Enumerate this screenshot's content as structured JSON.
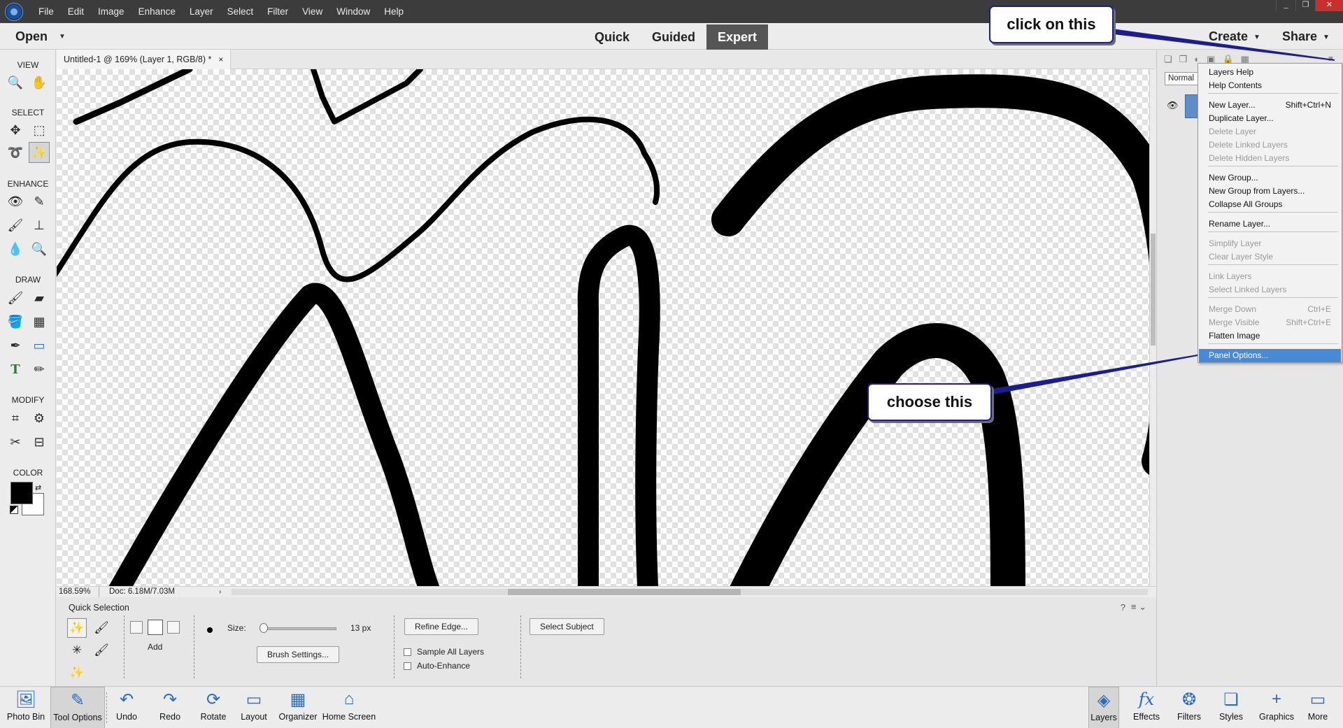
{
  "menubar": {
    "items": [
      "File",
      "Edit",
      "Image",
      "Enhance",
      "Layer",
      "Select",
      "Filter",
      "View",
      "Window",
      "Help"
    ],
    "window_controls": [
      "_",
      "❐",
      "✕"
    ]
  },
  "modebar": {
    "open_label": "Open",
    "modes": [
      "Quick",
      "Guided",
      "Expert"
    ],
    "active_mode": "Expert",
    "create_label": "Create",
    "share_label": "Share"
  },
  "toolbox": {
    "sections": [
      "VIEW",
      "SELECT",
      "ENHANCE",
      "DRAW",
      "MODIFY",
      "COLOR"
    ],
    "tools": [
      {
        "name": "zoom-tool-icon",
        "glyph": "🔍"
      },
      {
        "name": "hand-tool-icon",
        "glyph": "✋"
      },
      {
        "name": "move-tool-icon",
        "glyph": "✥"
      },
      {
        "name": "marquee-tool-icon",
        "glyph": "⬚"
      },
      {
        "name": "lasso-tool-icon",
        "glyph": "➰"
      },
      {
        "name": "quick-selection-tool-icon",
        "glyph": "✨"
      },
      {
        "name": "red-eye-tool-icon",
        "glyph": "👁"
      },
      {
        "name": "spot-healing-tool-icon",
        "glyph": "✎"
      },
      {
        "name": "smart-brush-tool-icon",
        "glyph": "🖌"
      },
      {
        "name": "clone-stamp-tool-icon",
        "glyph": "⊥"
      },
      {
        "name": "blur-tool-icon",
        "glyph": "💧"
      },
      {
        "name": "sponge-tool-icon",
        "glyph": "🔍"
      },
      {
        "name": "brush-tool-icon",
        "glyph": "🖌"
      },
      {
        "name": "eraser-tool-icon",
        "glyph": "▰"
      },
      {
        "name": "paint-bucket-tool-icon",
        "glyph": "🪣"
      },
      {
        "name": "gradient-tool-icon",
        "glyph": "▦"
      },
      {
        "name": "eyedropper-tool-icon",
        "glyph": "✒"
      },
      {
        "name": "shape-tool-icon",
        "glyph": "▭"
      },
      {
        "name": "type-tool-icon",
        "glyph": "T"
      },
      {
        "name": "pencil-tool-icon",
        "glyph": "✏"
      },
      {
        "name": "crop-tool-icon",
        "glyph": "⌗"
      },
      {
        "name": "recompose-tool-icon",
        "glyph": "⚙"
      },
      {
        "name": "content-aware-move-tool-icon",
        "glyph": "✂"
      },
      {
        "name": "straighten-tool-icon",
        "glyph": "⊟"
      }
    ]
  },
  "document": {
    "tab_title": "Untitled-1 @ 169% (Layer 1, RGB/8) *",
    "close_glyph": "×"
  },
  "status": {
    "zoom": "168.59%",
    "doc_size": "Doc: 6.18M/7.03M",
    "arrow": "›"
  },
  "tool_options": {
    "title": "Quick Selection",
    "mode_label": "Add",
    "size_label": "Size:",
    "size_value": "13 px",
    "size_fraction": 0.05,
    "brush_settings": "Brush Settings...",
    "refine_edge": "Refine Edge...",
    "sample_all_layers": "Sample All Layers",
    "auto_enhance": "Auto-Enhance",
    "select_subject": "Select Subject",
    "help_glyph": "?",
    "menu_glyph": "≡ ⌄"
  },
  "layers_panel": {
    "blend_mode": "Normal",
    "eye_glyph": "👁",
    "menu_glyph": "≡"
  },
  "context_menu": {
    "items": [
      {
        "label": "Layers Help",
        "shortcut": "",
        "disabled": false,
        "sep_before": false
      },
      {
        "label": "Help Contents",
        "shortcut": "",
        "disabled": false,
        "sep_before": false
      },
      {
        "label": "New Layer...",
        "shortcut": "Shift+Ctrl+N",
        "disabled": false,
        "sep_before": true
      },
      {
        "label": "Duplicate Layer...",
        "shortcut": "",
        "disabled": false,
        "sep_before": false
      },
      {
        "label": "Delete Layer",
        "shortcut": "",
        "disabled": true,
        "sep_before": false
      },
      {
        "label": "Delete Linked Layers",
        "shortcut": "",
        "disabled": true,
        "sep_before": false
      },
      {
        "label": "Delete Hidden Layers",
        "shortcut": "",
        "disabled": true,
        "sep_before": false
      },
      {
        "label": "New Group...",
        "shortcut": "",
        "disabled": false,
        "sep_before": true
      },
      {
        "label": "New Group from Layers...",
        "shortcut": "",
        "disabled": false,
        "sep_before": false
      },
      {
        "label": "Collapse All Groups",
        "shortcut": "",
        "disabled": false,
        "sep_before": false
      },
      {
        "label": "Rename Layer...",
        "shortcut": "",
        "disabled": false,
        "sep_before": true
      },
      {
        "label": "Simplify Layer",
        "shortcut": "",
        "disabled": true,
        "sep_before": true
      },
      {
        "label": "Clear Layer Style",
        "shortcut": "",
        "disabled": true,
        "sep_before": false
      },
      {
        "label": "Link Layers",
        "shortcut": "",
        "disabled": true,
        "sep_before": true
      },
      {
        "label": "Select Linked Layers",
        "shortcut": "",
        "disabled": true,
        "sep_before": false
      },
      {
        "label": "Merge Down",
        "shortcut": "Ctrl+E",
        "disabled": true,
        "sep_before": true
      },
      {
        "label": "Merge Visible",
        "shortcut": "Shift+Ctrl+E",
        "disabled": true,
        "sep_before": false
      },
      {
        "label": "Flatten Image",
        "shortcut": "",
        "disabled": false,
        "sep_before": false
      },
      {
        "label": "Panel Options...",
        "shortcut": "",
        "disabled": false,
        "sep_before": true,
        "highlighted": true
      }
    ]
  },
  "callouts": {
    "top": "click on this",
    "bottom": "choose this"
  },
  "taskbar": {
    "left": [
      {
        "label": "Photo Bin",
        "glyph": "🖼",
        "name": "photo-bin-button"
      },
      {
        "label": "Tool Options",
        "glyph": "✎",
        "name": "tool-options-button",
        "active": true
      },
      {
        "label": "Undo",
        "glyph": "↶",
        "name": "undo-button"
      },
      {
        "label": "Redo",
        "glyph": "↷",
        "name": "redo-button"
      },
      {
        "label": "Rotate",
        "glyph": "⟳",
        "name": "rotate-button"
      },
      {
        "label": "Layout",
        "glyph": "▭",
        "name": "layout-button"
      },
      {
        "label": "Organizer",
        "glyph": "▦",
        "name": "organizer-button"
      },
      {
        "label": "Home Screen",
        "glyph": "⌂",
        "name": "home-screen-button"
      }
    ],
    "right": [
      {
        "label": "Layers",
        "glyph": "◈",
        "name": "layers-button",
        "active": true
      },
      {
        "label": "Effects",
        "glyph": "fx",
        "name": "effects-button"
      },
      {
        "label": "Filters",
        "glyph": "❂",
        "name": "filters-button"
      },
      {
        "label": "Styles",
        "glyph": "❏",
        "name": "styles-button"
      },
      {
        "label": "Graphics",
        "glyph": "+",
        "name": "graphics-button"
      },
      {
        "label": "More",
        "glyph": "▭",
        "name": "more-button"
      }
    ]
  },
  "colors": {
    "accent": "#4a8ad4",
    "callout_border": "#1d1d8f",
    "menubar": "#3c3c3c",
    "foreground_color": "#000000",
    "background_color": "#ffffff"
  }
}
